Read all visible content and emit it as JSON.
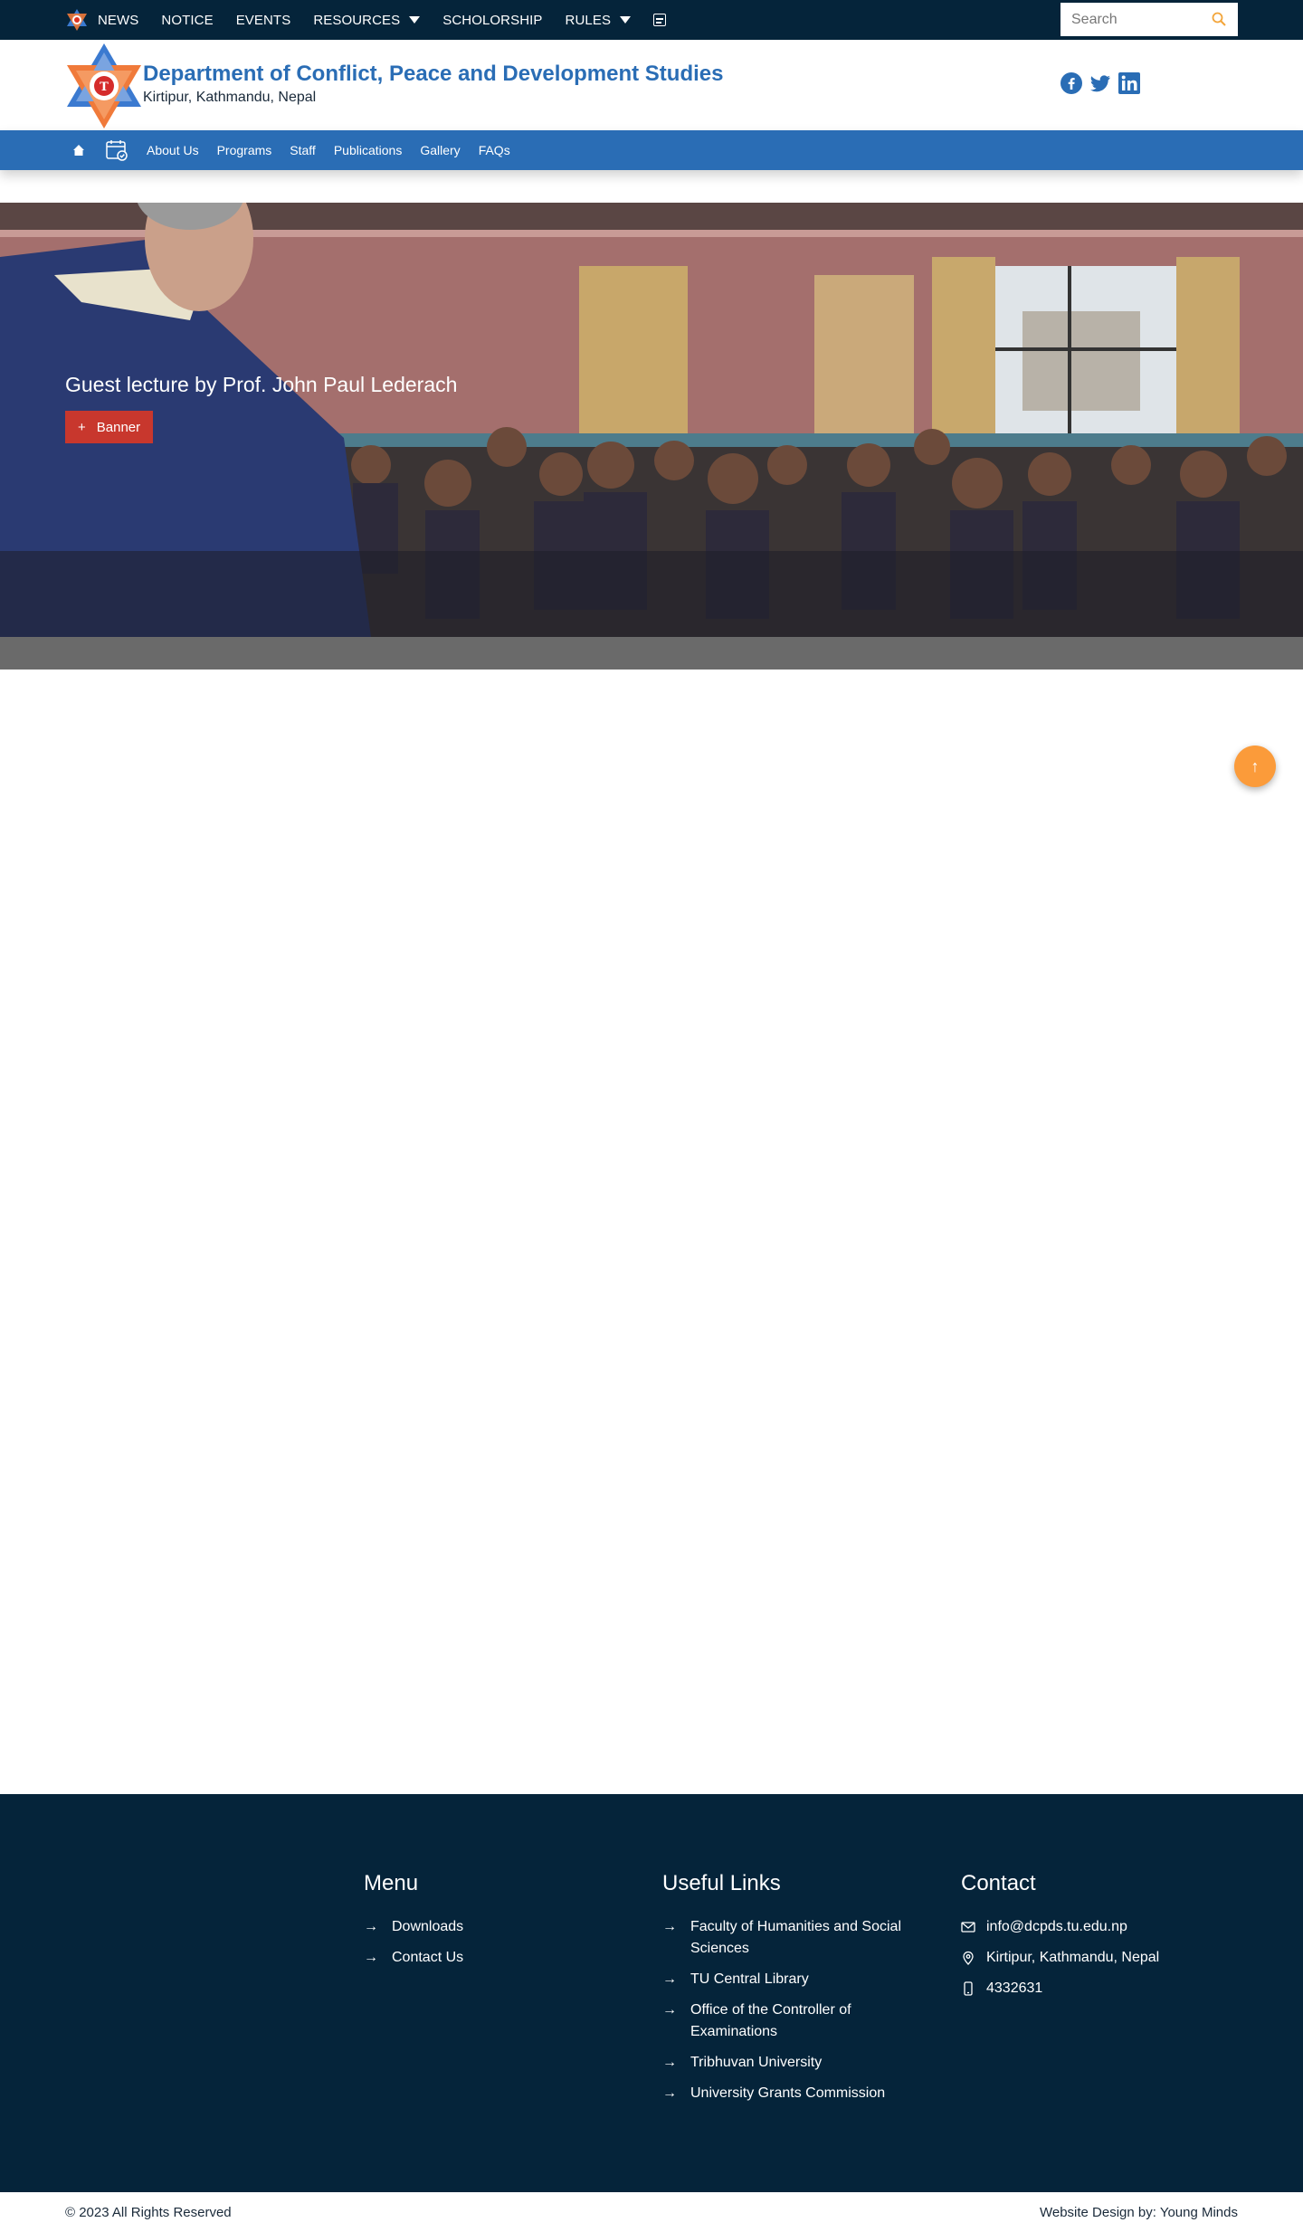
{
  "topbar": {
    "items": [
      {
        "label": "NEWS"
      },
      {
        "label": "NOTICE"
      },
      {
        "label": "EVENTS"
      },
      {
        "label": "RESOURCES"
      },
      {
        "label": "SCHOLORSHIP"
      },
      {
        "label": "RULES"
      }
    ],
    "search_placeholder": "Search"
  },
  "header": {
    "title": "Department of Conflict, Peace and Development Studies",
    "subtitle": "Kirtipur, Kathmandu, Nepal",
    "social": [
      "facebook-icon",
      "twitter-icon",
      "linkedin-icon"
    ]
  },
  "nav": {
    "items": [
      {
        "label": "About Us"
      },
      {
        "label": "Programs"
      },
      {
        "label": "Staff"
      },
      {
        "label": "Publications"
      },
      {
        "label": "Gallery"
      },
      {
        "label": "FAQs"
      }
    ]
  },
  "banner": {
    "caption": "Guest lecture by Prof. John Paul Lederach",
    "button_label": "Banner",
    "button_symbol": "+"
  },
  "scroll_top": {
    "symbol": "↑"
  },
  "footer": {
    "menu": {
      "heading": "Menu",
      "links": [
        "Downloads",
        "Contact Us"
      ]
    },
    "useful": {
      "heading": "Useful Links",
      "links": [
        "Faculty of Humanities and Social Sciences",
        "TU Central Library",
        "Office of the Controller of Examinations",
        "Tribhuvan University",
        "University Grants Commission"
      ]
    },
    "contact": {
      "heading": "Contact",
      "email": "info@dcpds.tu.edu.np",
      "address": "Kirtipur, Kathmandu, Nepal",
      "phone": "4332631"
    },
    "arrow_symbol": "→",
    "copyright": "© 2023 All Rights Reserved",
    "credit": "Website Design by: Young Minds"
  },
  "colors": {
    "topbar": "#05243a",
    "brand_blue": "#2a6db5",
    "banner_button": "#c8372d",
    "scroll_button": "#fb9b3a"
  }
}
